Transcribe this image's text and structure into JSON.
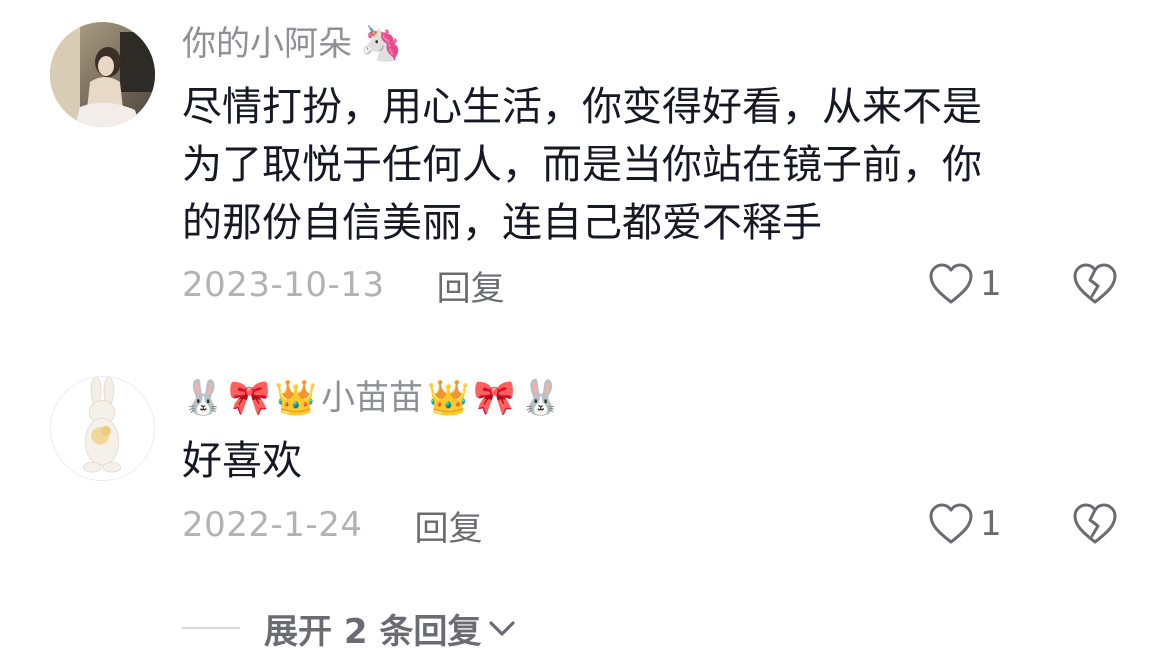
{
  "comments": [
    {
      "username": "你的小阿朵",
      "username_suffix_emoji": "🦄",
      "text_lines": [
        "尽情打扮，用心生活，你变得好看，从来不是",
        "为了取悦于任何人，而是当你站在镜子前，你",
        "的那份自信美丽，连自己都爱不释手"
      ],
      "date": "2023-10-13",
      "reply_label": "回复",
      "like_count": "1"
    },
    {
      "username_prefix_emojis": [
        "🐰",
        "🎀",
        "👑"
      ],
      "username": "小苗苗",
      "username_suffix_emojis": [
        "👑",
        "🎀",
        "🐰"
      ],
      "text": "好喜欢",
      "date": "2022-1-24",
      "reply_label": "回复",
      "like_count": "1"
    }
  ],
  "expand_replies": {
    "label": "展开 2 条回复"
  },
  "icons": {
    "like": "heart-outline-icon",
    "dislike": "broken-heart-icon",
    "expand": "chevron-down-icon"
  },
  "colors": {
    "text": "#161823",
    "username": "#8f8f96",
    "meta": "#b2b2b6",
    "action": "#6b6b72"
  }
}
